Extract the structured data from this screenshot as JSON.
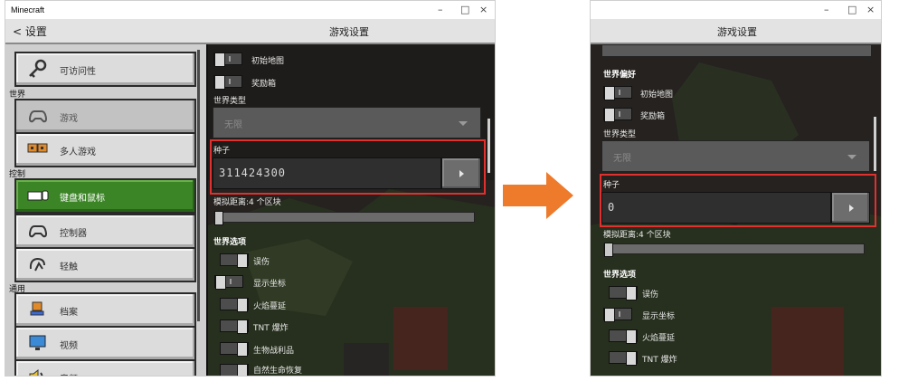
{
  "left_window": {
    "title": "Minecraft",
    "controls": {
      "minimize": "–",
      "maximize": "□",
      "close": "×"
    },
    "back_label": "< 设置",
    "header_title": "游戏设置",
    "sidebar": {
      "items": [
        {
          "label": "可访问性",
          "icon": "key-icon"
        },
        {
          "section": "世界"
        },
        {
          "label": "游戏",
          "icon": "controller-icon"
        },
        {
          "label": "多人游戏",
          "icon": "multiplayer-icon"
        },
        {
          "section": "控制"
        },
        {
          "label": "键盘和鼠标",
          "icon": "keyboard-mouse-icon"
        },
        {
          "label": "控制器",
          "icon": "controller-icon"
        },
        {
          "label": "轻触",
          "icon": "touch-icon"
        },
        {
          "section": "通用"
        },
        {
          "label": "档案",
          "icon": "profile-icon"
        },
        {
          "label": "视频",
          "icon": "monitor-icon"
        },
        {
          "label": "音频",
          "icon": "speaker-icon"
        }
      ]
    },
    "content": {
      "starter_map": "初始地图",
      "bonus_chest": "奖励箱",
      "world_type_label": "世界类型",
      "world_type_value": "无限",
      "seed_label": "种子",
      "seed_value": "311424300",
      "sim_distance": "模拟距离:4 个区块",
      "sim_distance_level": 0,
      "world_options_title": "世界选项",
      "toggles": [
        "误伤",
        "显示坐标",
        "火焰蔓延",
        "TNT 爆炸",
        "生物战利品",
        "自然生命恢复"
      ]
    }
  },
  "right_window": {
    "controls": {
      "minimize": "–",
      "maximize": "□",
      "close": "×"
    },
    "header_title": "游戏设置",
    "content": {
      "world_prefs_title": "世界偏好",
      "starter_map": "初始地图",
      "bonus_chest": "奖励箱",
      "world_type_label": "世界类型",
      "world_type_value": "无限",
      "seed_label": "种子",
      "seed_value": "0",
      "sim_distance": "模拟距离:4 个区块",
      "sim_distance_level": 0,
      "world_options_title": "世界选项",
      "toggles": [
        "误伤",
        "显示坐标",
        "火焰蔓延",
        "TNT 爆炸"
      ]
    }
  },
  "colors": {
    "accent_red": "#e03030",
    "arrow_orange": "#ee7a2c",
    "selected_green": "#3c8527"
  }
}
